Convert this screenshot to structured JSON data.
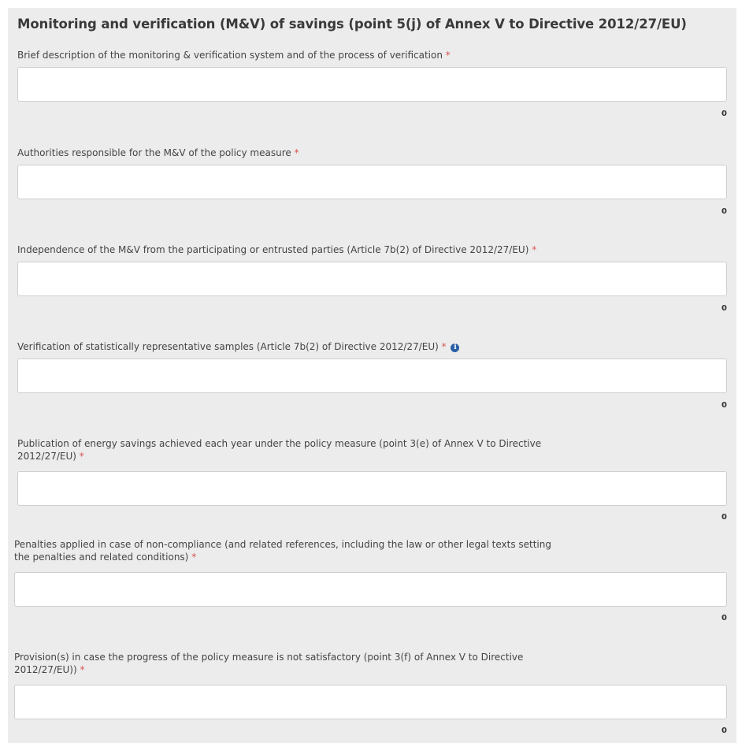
{
  "section": {
    "title": "Monitoring and verification (M&V) of savings (point 5(j) of Annex V to Directive 2012/27/EU)"
  },
  "required_marker": "*",
  "fields": [
    {
      "label": "Brief description of the monitoring & verification system and of the process of verification",
      "value": "",
      "char_count": "0"
    },
    {
      "label": "Authorities responsible for the M&V of the policy measure",
      "value": "",
      "char_count": "0"
    },
    {
      "label": "Independence of the M&V from the participating or entrusted parties (Article 7b(2) of Directive 2012/27/EU)",
      "value": "",
      "char_count": "0"
    },
    {
      "label": "Verification of statistically representative samples (Article 7b(2) of Directive 2012/27/EU)",
      "value": "",
      "char_count": "0",
      "info_icon": "info-icon"
    },
    {
      "label_line1": "Publication of energy savings achieved each year under the policy measure (point 3(e) of Annex V to Directive",
      "label_line2": "2012/27/EU)",
      "value": "",
      "char_count": "0"
    },
    {
      "label_line1": "Penalties applied in case of non-compliance (and related references, including the law or other legal texts setting",
      "label_line2": "the penalties and related conditions)",
      "value": "",
      "char_count": "0"
    },
    {
      "label_line1": "Provision(s) in case the progress of the policy measure is not satisfactory (point 3(f) of Annex V to Directive",
      "label_line2": "2012/27/EU))",
      "value": "",
      "char_count": "0"
    }
  ],
  "colors": {
    "panel_bg": "#ececec",
    "required": "#d9534f",
    "info": "#2a5fa6"
  }
}
